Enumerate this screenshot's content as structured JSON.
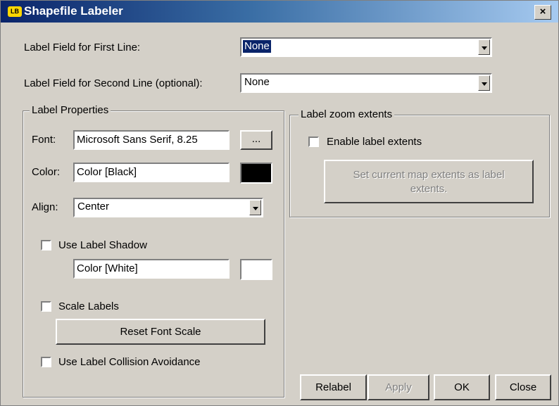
{
  "window": {
    "title": "Shapefile Labeler",
    "icon_text": "LB",
    "close_glyph": "×"
  },
  "label_fields": {
    "first_line_label": "Label Field for First Line:",
    "first_line_value": "None",
    "second_line_label": "Label Field for Second Line (optional):",
    "second_line_value": "None"
  },
  "label_properties": {
    "group_title": "Label Properties",
    "font_label": "Font:",
    "font_value": "Microsoft Sans Serif, 8.25",
    "font_button": "...",
    "color_label": "Color:",
    "color_value": "Color [Black]",
    "color_swatch": "#000000",
    "align_label": "Align:",
    "align_value": "Center",
    "shadow_label": "Use Label Shadow",
    "shadow_checked": false,
    "shadow_color_value": "Color [White]",
    "shadow_swatch": "#ffffff",
    "scale_label": "Scale Labels",
    "scale_checked": false,
    "reset_font_scale": "Reset Font Scale",
    "collision_label": "Use Label Collision Avoidance",
    "collision_checked": false
  },
  "zoom_extents": {
    "group_title": "Label zoom extents",
    "enable_label": "Enable label extents",
    "enable_checked": false,
    "set_extents_button": "Set current map extents as label extents."
  },
  "buttons": {
    "relabel": "Relabel",
    "apply": "Apply",
    "ok": "OK",
    "close": "Close"
  }
}
